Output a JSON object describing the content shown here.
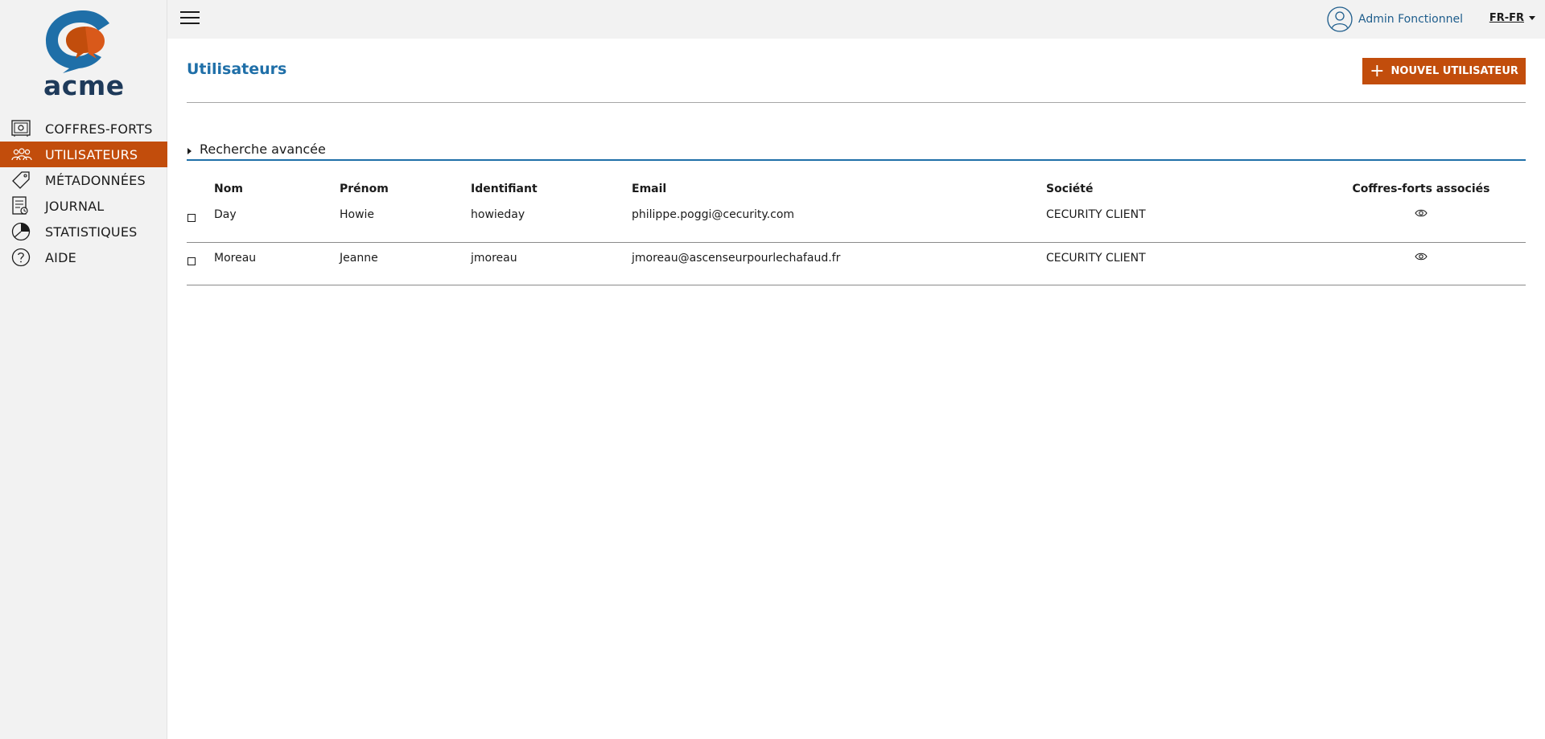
{
  "brand": {
    "name": "acme",
    "primary_color": "#c24d0c",
    "accent_color": "#1f6fa8",
    "logo_text_color": "#1e3a5a"
  },
  "sidebar": {
    "items": [
      {
        "label": "COFFRES-FORTS",
        "icon": "safe-icon",
        "active": false
      },
      {
        "label": "UTILISATEURS",
        "icon": "users-icon",
        "active": true
      },
      {
        "label": "MÉTADONNÉES",
        "icon": "tag-icon",
        "active": false
      },
      {
        "label": "JOURNAL",
        "icon": "journal-icon",
        "active": false
      },
      {
        "label": "STATISTIQUES",
        "icon": "pie-chart-icon",
        "active": false
      },
      {
        "label": "AIDE",
        "icon": "help-icon",
        "active": false
      }
    ]
  },
  "header": {
    "user_name": "Admin Fonctionnel",
    "language": "FR-FR"
  },
  "page": {
    "title": "Utilisateurs",
    "new_button_label": "NOUVEL UTILISATEUR",
    "advanced_search_label": "Recherche avancée"
  },
  "table": {
    "columns": [
      "Nom",
      "Prénom",
      "Identifiant",
      "Email",
      "Société",
      "Coffres-forts associés"
    ],
    "rows": [
      {
        "nom": "Day",
        "prenom": "Howie",
        "identifiant": "howieday",
        "email": "philippe.poggi@cecurity.com",
        "societe": "CECURITY CLIENT"
      },
      {
        "nom": "Moreau",
        "prenom": "Jeanne",
        "identifiant": "jmoreau",
        "email": "jmoreau@ascenseurpourlechafaud.fr",
        "societe": "CECURITY CLIENT"
      }
    ]
  }
}
